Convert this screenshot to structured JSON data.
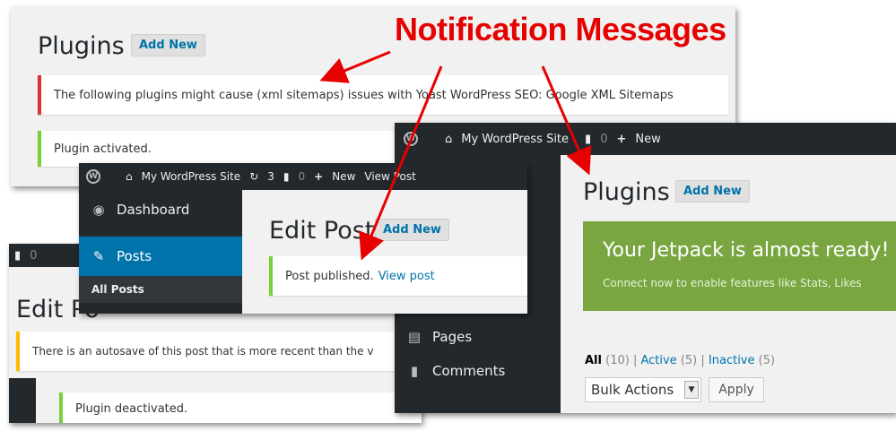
{
  "annotation": {
    "title": "Notification Messages",
    "color": "#e60000"
  },
  "panel1": {
    "title": "Plugins",
    "add_new": "Add New",
    "notice_error": "The following plugins might cause (xml sitemaps) issues with Yoast WordPress SEO: Google XML Sitemaps",
    "notice_success": "Plugin activated."
  },
  "panel2": {
    "bar": {
      "site": "My WordPress Site",
      "updates": "3",
      "comments": "0",
      "new": "New",
      "view_post": "View Post"
    },
    "sidebar": [
      {
        "icon": "dashboard-icon",
        "label": "Dashboard"
      },
      {
        "icon": "pin-icon",
        "label": "Posts"
      },
      {
        "icon": "",
        "label": "All Posts"
      }
    ],
    "title": "Edit Post",
    "add_new": "Add New",
    "notice_text": "Post published.",
    "notice_link": "View post"
  },
  "panel3": {
    "bar_comments": "0",
    "title": "Edit Po",
    "notice_warning": "There is an autosave of this post that is more recent than the v",
    "notice_deactivated": "Plugin deactivated."
  },
  "panel4": {
    "bar": {
      "site": "My WordPress Site",
      "comments": "0",
      "new": "New"
    },
    "sidebar": [
      {
        "icon": "pages-icon",
        "label": "Pages"
      },
      {
        "icon": "comments-icon",
        "label": "Comments"
      }
    ],
    "title": "Plugins",
    "add_new": "Add New",
    "jetpack_title": "Your Jetpack is almost ready!",
    "jetpack_sub": "Connect now to enable features like Stats, Likes",
    "filters": [
      {
        "label": "All",
        "count": "(10)"
      },
      {
        "label": "Active",
        "count": "(5)"
      },
      {
        "label": "Inactive",
        "count": "(5)"
      }
    ],
    "bulk": "Bulk Actions",
    "apply": "Apply"
  },
  "colors": {
    "jetpack": "#7aa641",
    "wp_blue": "#0073aa",
    "error": "#dc3232",
    "success": "#7ad03a",
    "warning": "#ffba00"
  }
}
